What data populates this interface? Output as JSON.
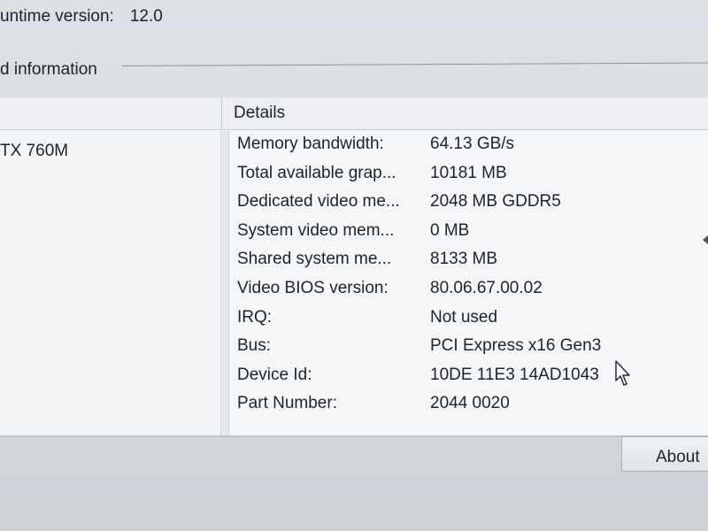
{
  "runtime": {
    "label": "untime version:",
    "value": "12.0"
  },
  "group": {
    "title": "d information"
  },
  "table": {
    "details_header": "Details",
    "gpu_item": "TX 760M"
  },
  "details": [
    {
      "label": "Memory bandwidth:",
      "value": "64.13 GB/s"
    },
    {
      "label": "Total available grap...",
      "value": "10181 MB"
    },
    {
      "label": "Dedicated video me...",
      "value": "2048 MB GDDR5"
    },
    {
      "label": "System video mem...",
      "value": "0 MB"
    },
    {
      "label": "Shared system me...",
      "value": "8133 MB"
    },
    {
      "label": "Video BIOS version:",
      "value": "80.06.67.00.02"
    },
    {
      "label": "IRQ:",
      "value": "Not used"
    },
    {
      "label": "Bus:",
      "value": "PCI Express x16 Gen3"
    },
    {
      "label": "Device Id:",
      "value": "10DE 11E3 14AD1043"
    },
    {
      "label": "Part Number:",
      "value": "2044 0020"
    }
  ],
  "buttons": {
    "about_label": "About"
  },
  "icons": {
    "cursor": "mouse-pointer-icon",
    "scroll": "scroll-left-arrow-icon"
  }
}
